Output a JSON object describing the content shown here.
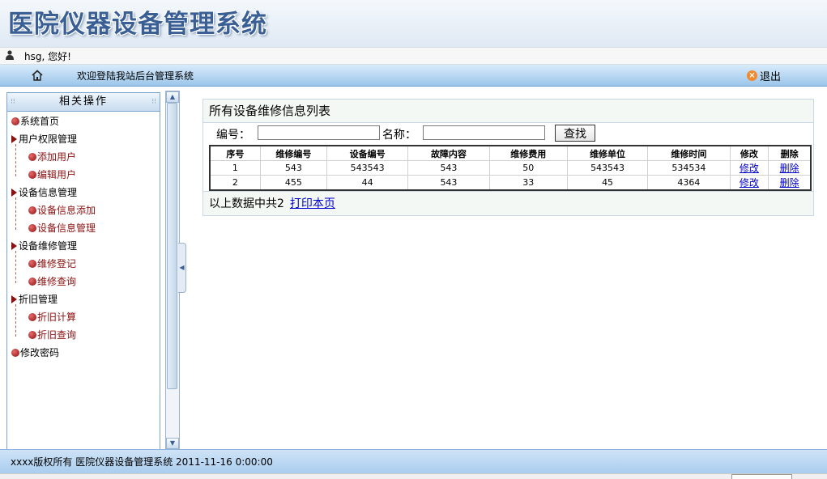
{
  "header": {
    "title": "医院仪器设备管理系统"
  },
  "userbar": {
    "greeting": "hsg, 您好!"
  },
  "nav": {
    "welcome": "欢迎登陆我站后台管理系统",
    "logout": "退出"
  },
  "sidebar": {
    "title": "相关操作",
    "items": [
      {
        "label": "系统首页",
        "level": 0,
        "icon": "pin"
      },
      {
        "label": "用户权限管理",
        "level": 0,
        "icon": "arrow"
      },
      {
        "label": "添加用户",
        "level": 1,
        "icon": "pin"
      },
      {
        "label": "编辑用户",
        "level": 1,
        "icon": "pin"
      },
      {
        "label": "设备信息管理",
        "level": 0,
        "icon": "arrow"
      },
      {
        "label": "设备信息添加",
        "level": 1,
        "icon": "pin"
      },
      {
        "label": "设备信息管理",
        "level": 1,
        "icon": "pin"
      },
      {
        "label": "设备维修管理",
        "level": 0,
        "icon": "arrow"
      },
      {
        "label": "维修登记",
        "level": 1,
        "icon": "pin"
      },
      {
        "label": "维修查询",
        "level": 1,
        "icon": "pin"
      },
      {
        "label": "折旧管理",
        "level": 0,
        "icon": "arrow"
      },
      {
        "label": "折旧计算",
        "level": 1,
        "icon": "pin"
      },
      {
        "label": "折旧查询",
        "level": 1,
        "icon": "pin"
      },
      {
        "label": "修改密码",
        "level": 0,
        "icon": "pin"
      }
    ]
  },
  "main": {
    "caption": "所有设备维修信息列表",
    "search": {
      "id_label": "编号：",
      "name_label": "名称：",
      "id_value": "",
      "name_value": "",
      "button": "查找"
    },
    "table": {
      "headers": [
        "序号",
        "维修编号",
        "设备编号",
        "故障内容",
        "维修费用",
        "维修单位",
        "维修时间",
        "修改",
        "删除"
      ],
      "rows": [
        [
          "1",
          "543",
          "543543",
          "543",
          "50",
          "543543",
          "534534",
          "修改",
          "删除"
        ],
        [
          "2",
          "455",
          "44",
          "543",
          "33",
          "45",
          "4364",
          "修改",
          "删除"
        ]
      ]
    },
    "summary": "以上数据中共2",
    "print_link": "打印本页"
  },
  "footer": {
    "text": "xxxx版权所有  医院仪器设备管理系统 2011-11-16 0:00:00"
  },
  "colors": {
    "nav_gradient_top": "#d8ebfb",
    "nav_gradient_bottom": "#9cc6ea",
    "tree_accent": "#8b1010",
    "link": "#0000cc"
  },
  "icons": {
    "user": "user-icon",
    "home": "home-icon",
    "logout": "close-circle-icon",
    "tree_pin": "pushpin-icon",
    "tree_arrow": "triangle-right-icon"
  }
}
